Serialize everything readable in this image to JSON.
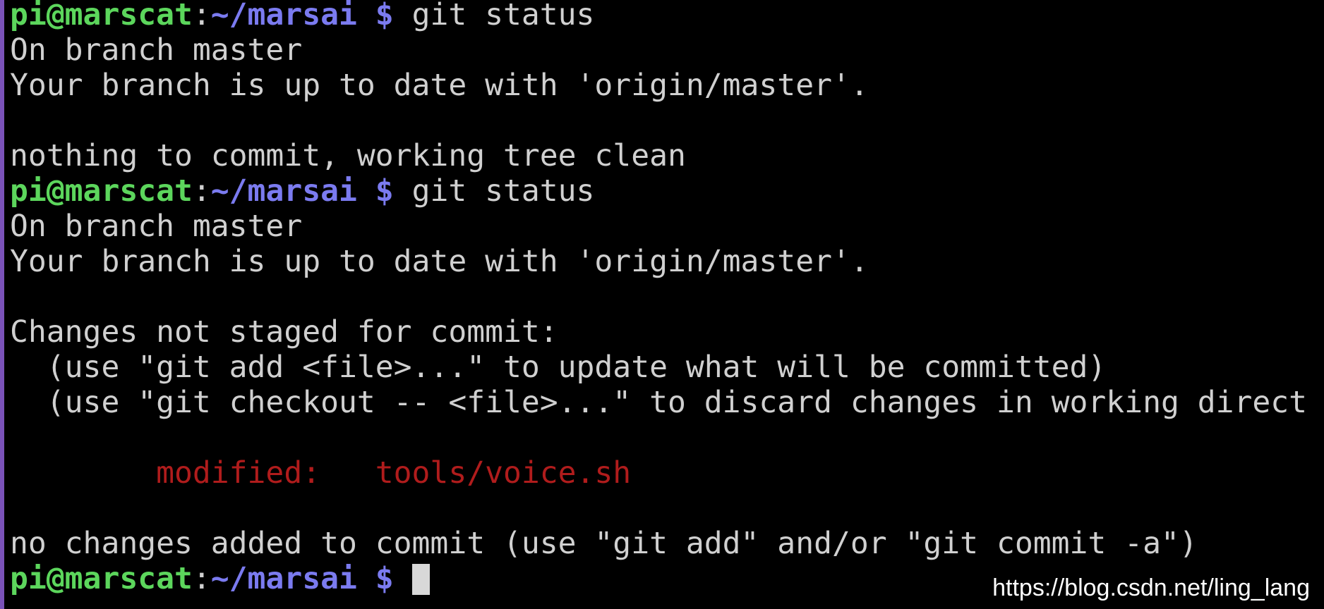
{
  "prompt": {
    "user_host": "pi@marscat",
    "colon": ":",
    "path": "~/marsai",
    "dollar": "$"
  },
  "session": {
    "cmd1": "git status",
    "out1_line1": "On branch master",
    "out1_line2": "Your branch is up to date with 'origin/master'.",
    "out1_line3": "",
    "out1_line4": "nothing to commit, working tree clean",
    "cmd2": "git status",
    "out2_line1": "On branch master",
    "out2_line2": "Your branch is up to date with 'origin/master'.",
    "out2_line3": "",
    "out2_line4": "Changes not staged for commit:",
    "out2_line5": "  (use \"git add <file>...\" to update what will be committed)",
    "out2_line6": "  (use \"git checkout -- <file>...\" to discard changes in working direct",
    "out2_line7": "",
    "modified_label": "        modified:   tools/voice.sh",
    "out2_line9": "",
    "out2_line10": "no changes added to commit (use \"git add\" and/or \"git commit -a\")"
  },
  "watermark": "https://blog.csdn.net/ling_lang",
  "colors": {
    "background": "#000000",
    "text": "#d0d0d0",
    "user_host": "#5cd65c",
    "path": "#7b7bf0",
    "modified": "#b01c1c",
    "left_border": "#7a52b8"
  }
}
